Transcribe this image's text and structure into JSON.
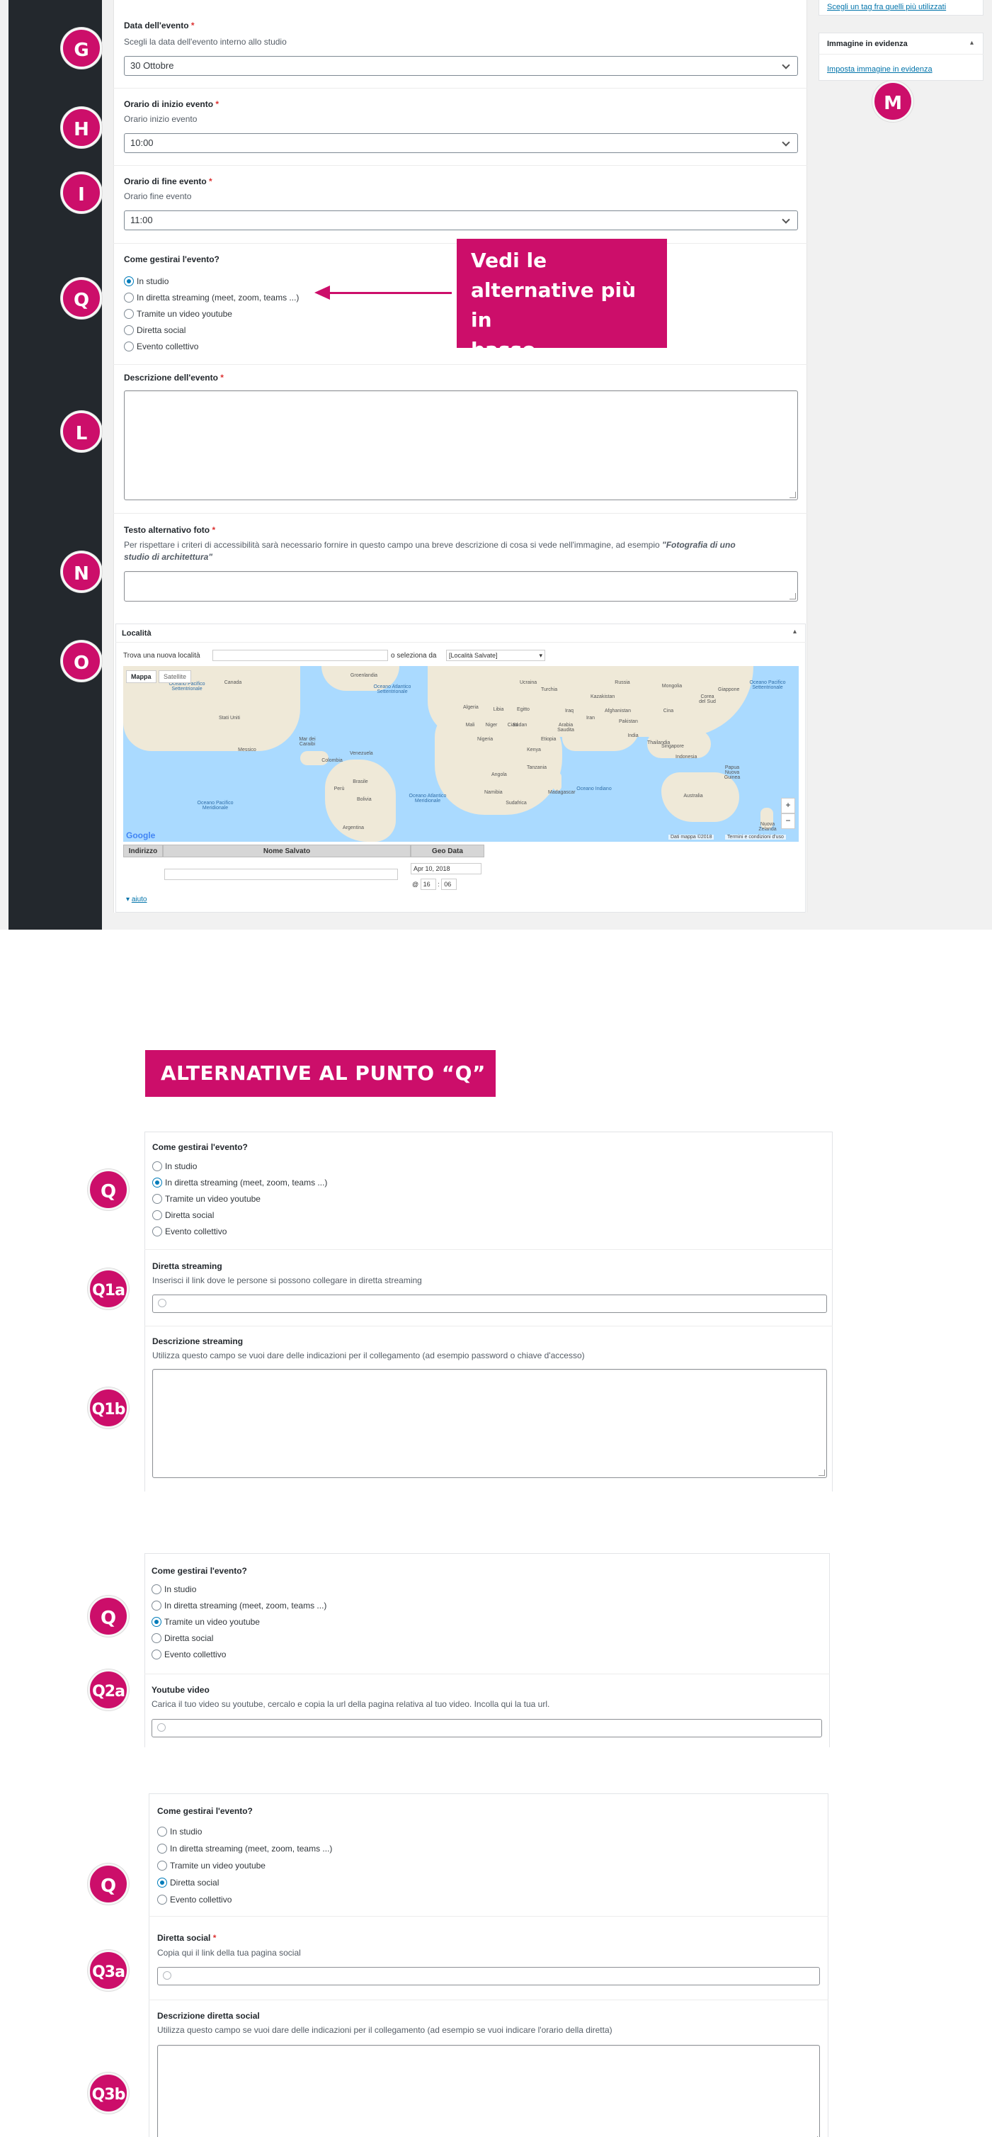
{
  "top": {
    "markers": [
      "G",
      "H",
      "I",
      "Q",
      "L",
      "N",
      "O",
      "M"
    ],
    "date": {
      "label": "Data dell'evento",
      "required": "*",
      "desc": "Scegli la data dell'evento interno allo studio",
      "value": "30 Ottobre"
    },
    "start": {
      "label": "Orario di inizio evento",
      "required": "*",
      "desc": "Orario inizio evento",
      "value": "10:00"
    },
    "end": {
      "label": "Orario di fine evento",
      "required": "*",
      "desc": "Orario fine evento",
      "value": "11:00"
    },
    "manage": {
      "label": "Come gestirai l'evento?",
      "options": [
        "In studio",
        "In diretta streaming (meet, zoom, teams ...)",
        "Tramite un video youtube",
        "Diretta social",
        "Evento collettivo"
      ],
      "selected": 0
    },
    "callout": [
      "Vedi le",
      "alternative più in",
      "basso"
    ],
    "description": {
      "label": "Descrizione dell'evento",
      "required": "*"
    },
    "alt_text": {
      "label": "Testo alternativo foto",
      "required": "*",
      "desc": "Per rispettare i criteri di accessibilità sarà necessario fornire in questo campo una breve descrizione di cosa si vede nell'immagine, ad esempio",
      "example_1": "\"Fotografia di uno",
      "example_2": "studio di architettura\""
    },
    "location": {
      "title": "Località",
      "find_label": "Trova una nuova località",
      "or_label": "o seleziona da",
      "select_value": "[Località Salvate]",
      "map_tabs": [
        "Mappa",
        "Satellite"
      ],
      "map_labels": [
        "Oceano Pacifico Settentrionale",
        "Oceano Atlantico Settentrionale",
        "Oceano Pacifico Settentrionale",
        "Oceano Pacifico Meridionale",
        "Oceano Atlantico Meridionale",
        "Oceano Indiano",
        "Russia",
        "Canada",
        "Stati Uniti",
        "Messico",
        "Brasile",
        "Australia",
        "Cina",
        "India",
        "Algeria",
        "Libia",
        "Egitto",
        "Nigeria",
        "Kenya",
        "Perù",
        "Argentina",
        "Sudafrica",
        "Kazakistan",
        "Iran",
        "Indonesia",
        "Mongolia",
        "Groenlandia",
        "Venezuela",
        "Colombia",
        "Bolivia",
        "Angola",
        "Tanzania",
        "Madagascar",
        "Turchia",
        "Afghanistan",
        "Arabia Saudita",
        "Sudan",
        "Etiopia",
        "Mali",
        "Niger",
        "Ciad",
        "Namibia",
        "Pakistan",
        "Iraq",
        "Thailandia",
        "Papua Nuova Guinea",
        "Nuova Zelanda",
        "Ucraina",
        "Singapore",
        "Corea del Sud",
        "Giappone",
        "Mar dei Caraibi"
      ],
      "map_footer": "Dati mappa ©2018",
      "map_terms": "Termini e condizioni d'uso",
      "google": "Google",
      "zoom_in": "+",
      "zoom_out": "−",
      "table_headers": [
        "Indirizzo",
        "Nome Salvato",
        "Geo Data"
      ],
      "date_value": "Apr 10, 2018",
      "time_prefix": "@",
      "time_h": "16",
      "time_sep": ":",
      "time_m": "06",
      "help_link": "aiuto",
      "help_caret": "▾"
    },
    "sidebar": {
      "tags_link": "Scegli un tag fra quelli più utilizzati",
      "featured_title": "Immagine in evidenza",
      "featured_link": "Imposta immagine in evidenza",
      "caret": "▴"
    }
  },
  "alternatives": {
    "banner": "ALTERNATIVE AL PUNTO “Q”",
    "question": "Come gestirai l'evento?",
    "options": [
      "In studio",
      "In diretta streaming (meet, zoom, teams ...)",
      "Tramite un video youtube",
      "Diretta social",
      "Evento collettivo"
    ],
    "q1": {
      "markers": [
        "Q",
        "Q1a",
        "Q1b"
      ],
      "selected": 1,
      "streaming_label": "Diretta streaming",
      "streaming_desc": "Inserisci il link dove le persone si possono collegare in diretta streaming",
      "desc_label": "Descrizione streaming",
      "desc_desc": "Utilizza questo campo se vuoi dare delle indicazioni per il collegamento (ad esempio password o chiave d'accesso)"
    },
    "q2": {
      "markers": [
        "Q",
        "Q2a"
      ],
      "selected": 2,
      "yt_label": "Youtube video",
      "yt_desc": "Carica il tuo video su youtube, cercalo e copia la url della pagina relativa al tuo video. Incolla qui la tua url."
    },
    "q3": {
      "markers": [
        "Q",
        "Q3a",
        "Q3b"
      ],
      "selected": 3,
      "social_label": "Diretta social",
      "required": "*",
      "social_desc": "Copia qui il link della tua pagina social",
      "desc_label": "Descrizione diretta social",
      "desc_desc": "Utilizza questo campo se vuoi dare delle indicazioni per il collegamento (ad esempio se vuoi indicare l'orario della diretta)"
    }
  },
  "colors": {
    "accent": "#cc0e6a",
    "wp_dark": "#23282d",
    "link": "#0073aa",
    "radio": "#007cba"
  }
}
